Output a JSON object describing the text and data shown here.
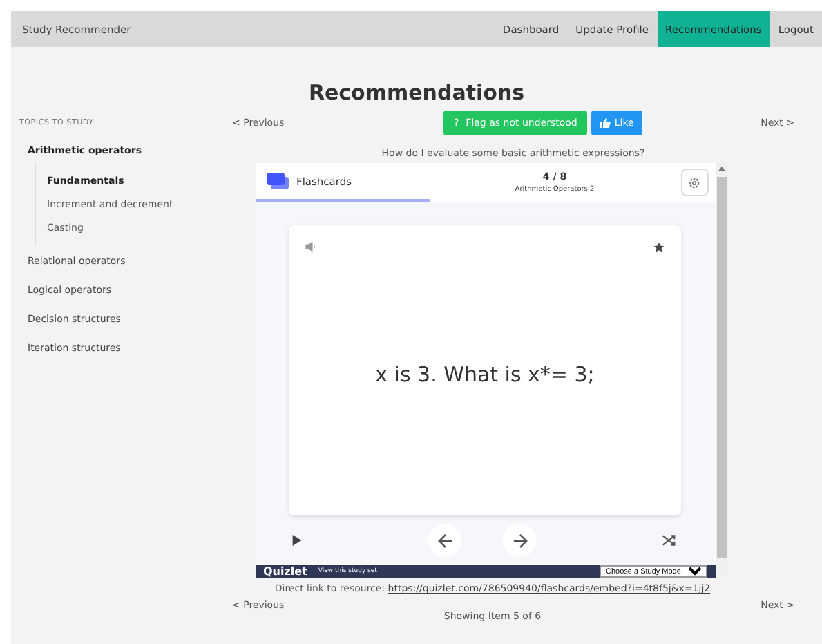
{
  "navbar": {
    "brand": "Study Recommender",
    "items": [
      {
        "label": "Dashboard",
        "selected": false
      },
      {
        "label": "Update Profile",
        "selected": false
      },
      {
        "label": "Recommendations",
        "selected": true
      },
      {
        "label": "Logout",
        "selected": false
      }
    ]
  },
  "heading": "Recommendations",
  "sidebar": {
    "title": "TOPICS TO STUDY",
    "items": [
      {
        "label": "Arithmetic operators",
        "selected": true,
        "children": [
          {
            "label": "Fundamentals",
            "selected": true
          },
          {
            "label": "Increment and decrement",
            "selected": false
          },
          {
            "label": "Casting",
            "selected": false
          }
        ]
      },
      {
        "label": "Relational operators",
        "selected": false
      },
      {
        "label": "Logical operators",
        "selected": false
      },
      {
        "label": "Decision structures",
        "selected": false
      },
      {
        "label": "Iteration structures",
        "selected": false
      }
    ]
  },
  "pager_top": {
    "previous": "< Previous",
    "next": "Next >"
  },
  "actions": {
    "flag": "Flag as not understood",
    "flag_icon": "?",
    "like": "Like"
  },
  "question": "How do I evaluate some basic arithmetic expressions?",
  "embed": {
    "mode_tab": "Flashcards",
    "progress": "4 / 8",
    "set_title": "Arithmetic Operators 2",
    "card_text": "x is 3. What is x*= 3;",
    "brand": "Quizlet",
    "view_link": "View this study set",
    "study_mode": "Choose a Study Mode"
  },
  "direct_link": {
    "label": "Direct link to resource:",
    "url": "https://quizlet.com/786509940/flashcards/embed?i=4t8f5j&x=1jj2"
  },
  "pager_bottom": {
    "previous": "< Previous",
    "next": "Next >",
    "status": "Showing Item 5 of 6"
  }
}
